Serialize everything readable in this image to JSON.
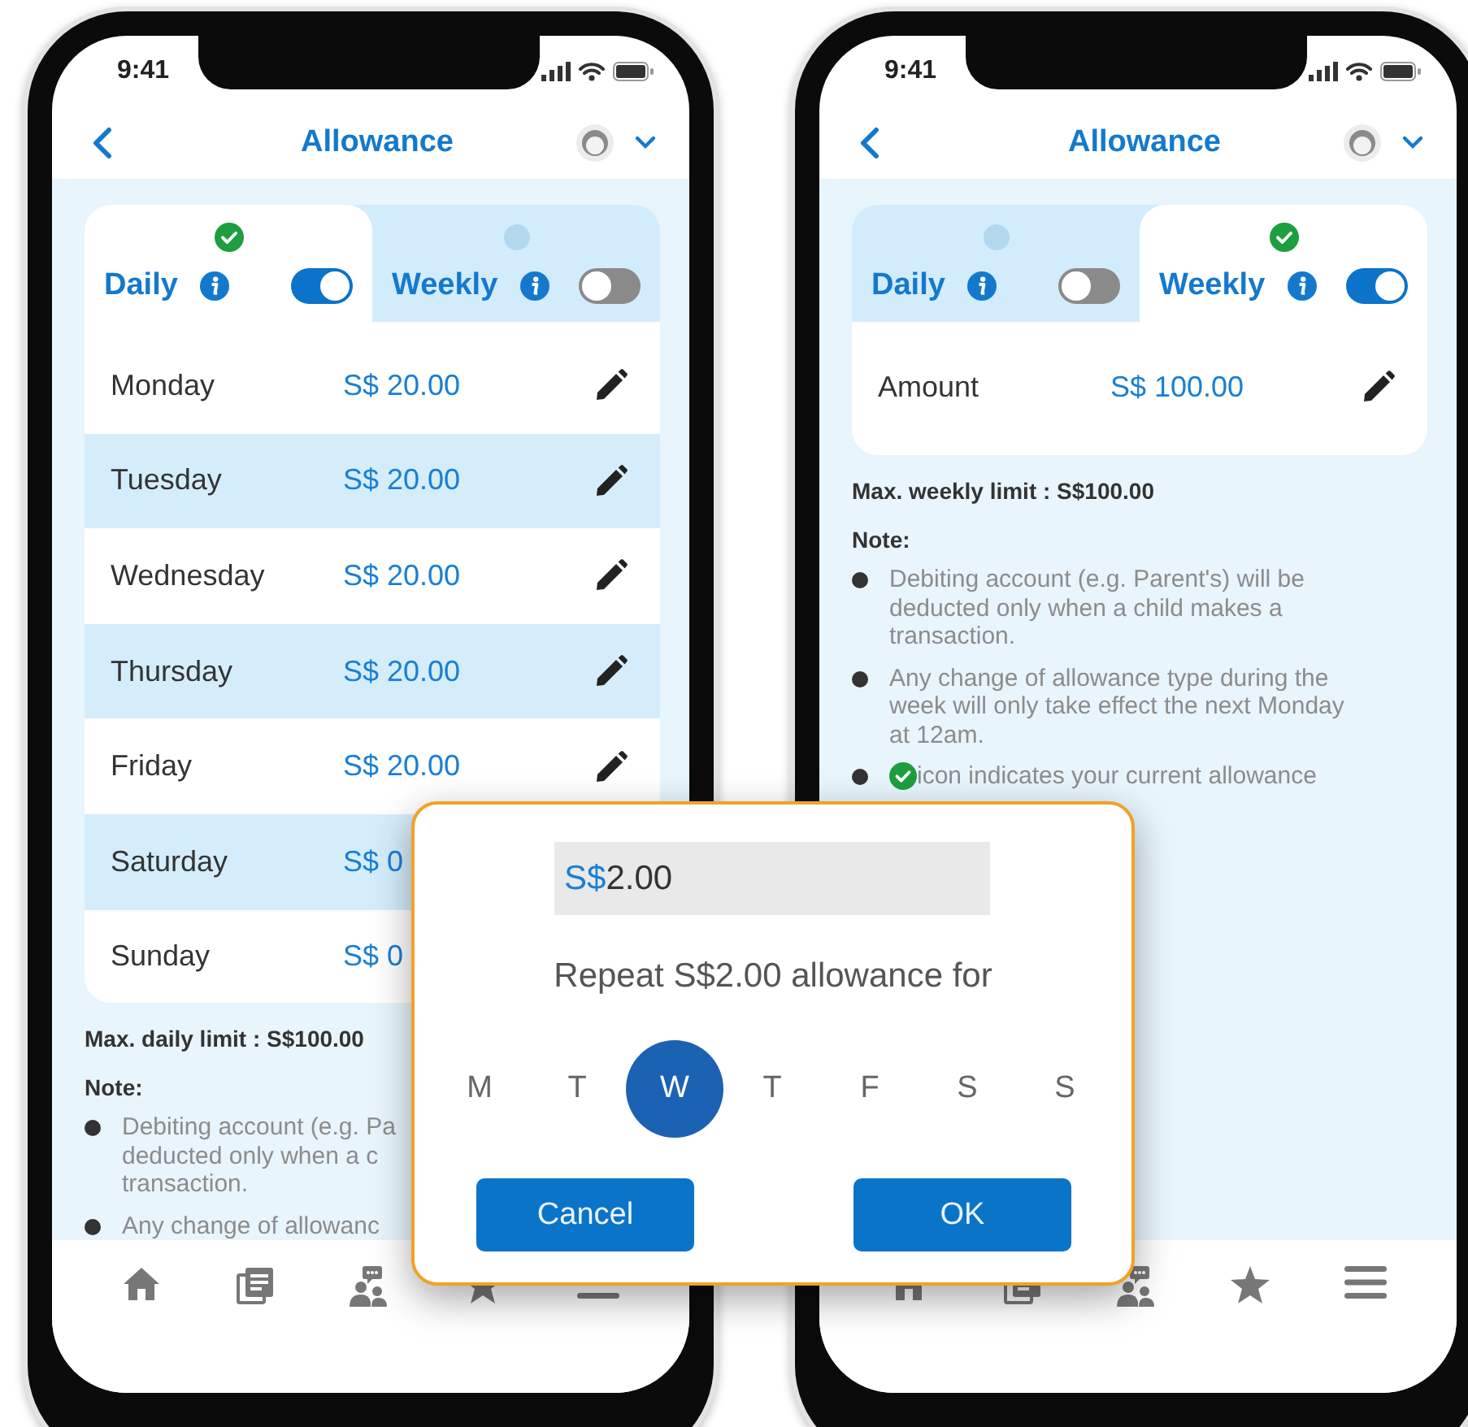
{
  "phones": [
    {
      "status_bar": {
        "time": "9:41"
      },
      "header": {
        "title": "Allowance"
      },
      "tabs": [
        {
          "label": "Daily",
          "selected": true,
          "on": true
        },
        {
          "label": "Weekly",
          "selected": false,
          "on": false
        }
      ],
      "rows": [
        {
          "label": "Monday",
          "amount": "S$ 20.00",
          "shaded": false,
          "edit_icon": true
        },
        {
          "label": "Tuesday",
          "amount": "S$ 20.00",
          "shaded": true,
          "edit_icon": true
        },
        {
          "label": "Wednesday",
          "amount": "S$ 20.00",
          "shaded": false,
          "edit_icon": true
        },
        {
          "label": "Thursday",
          "amount": "S$ 20.00",
          "shaded": true,
          "edit_icon": true
        },
        {
          "label": "Friday",
          "amount": "S$ 20.00",
          "shaded": false,
          "edit_icon": true
        },
        {
          "label": "Saturday",
          "amount": "S$ 0",
          "shaded": true,
          "edit_icon": false
        },
        {
          "label": "Sunday",
          "amount": "S$ 0",
          "shaded": false,
          "edit_icon": false
        }
      ],
      "limit": "Max. daily limit : S$100.00",
      "note_title": "Note:",
      "notes": [
        {
          "lines": [
            "Debiting account (e.g. Pa",
            "deducted only when a c",
            "transaction."
          ],
          "check_icon": false
        },
        {
          "lines": [
            "Any change of allowanc"
          ],
          "check_icon": false
        }
      ]
    },
    {
      "status_bar": {
        "time": "9:41"
      },
      "header": {
        "title": "Allowance"
      },
      "tabs": [
        {
          "label": "Daily",
          "selected": false,
          "on": false
        },
        {
          "label": "Weekly",
          "selected": true,
          "on": true
        }
      ],
      "rows": [
        {
          "label": "Amount",
          "amount": "S$ 100.00",
          "shaded": false,
          "edit_icon": true
        }
      ],
      "limit": "Max. weekly limit : S$100.00",
      "note_title": "Note:",
      "notes": [
        {
          "lines": [
            "Debiting account (e.g. Parent's) will be",
            "deducted only when a child makes a",
            "transaction."
          ],
          "check_icon": false
        },
        {
          "lines": [
            "Any change of allowance type during the",
            "week will only take effect the next Monday",
            "at 12am."
          ],
          "check_icon": false
        },
        {
          "lines": [
            "icon indicates your current allowance"
          ],
          "check_icon": true
        }
      ]
    }
  ],
  "dialog": {
    "field": {
      "currency": "S$",
      "value": "2.00"
    },
    "prompt": "Repeat S$2.00 allowance for",
    "days": [
      {
        "label": "M",
        "selected": false
      },
      {
        "label": "T",
        "selected": false
      },
      {
        "label": "W",
        "selected": true
      },
      {
        "label": "T",
        "selected": false
      },
      {
        "label": "F",
        "selected": false
      },
      {
        "label": "S",
        "selected": false
      },
      {
        "label": "S",
        "selected": false
      }
    ],
    "buttons": [
      {
        "label": "Cancel"
      },
      {
        "label": "OK"
      }
    ]
  }
}
